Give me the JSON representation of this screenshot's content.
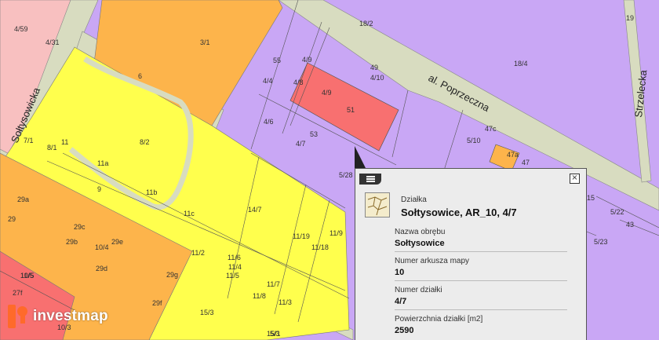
{
  "map": {
    "street_labels": [
      "Sołtysowicka",
      "al. Poprzeczna",
      "Strzelecka"
    ],
    "parcel_labels": [
      "4/59",
      "4/31",
      "3/1",
      "18/2",
      "18/4",
      "19",
      "6",
      "55",
      "4/4",
      "4/9",
      "4/8",
      "49",
      "4/10",
      "51",
      "4/9",
      "4/6",
      "53",
      "4/7",
      "47c",
      "5/10",
      "47a",
      "47",
      "5/28",
      "8/1",
      "7/1",
      "11",
      "8/2",
      "11a",
      "11b",
      "11c",
      "14/7",
      "9",
      "29a",
      "29",
      "29c",
      "29b",
      "10/4",
      "29e",
      "29d",
      "29g",
      "29f",
      "11/19",
      "11/18",
      "11/9",
      "11/6",
      "11/4",
      "11/5",
      "11/2",
      "11/7",
      "11/8",
      "11/3",
      "15/1",
      "15/3",
      "5/22",
      "43",
      "5/23",
      "11/5",
      "27f",
      "10/3",
      "10/5",
      "15",
      "5/3"
    ]
  },
  "popup": {
    "menu_icon": "list-icon",
    "close_label": "×",
    "kind": "Działka",
    "title": "Sołtysowice, AR_10, 4/7",
    "fields": [
      {
        "label": "Nazwa obrębu",
        "value": "Sołtysowice"
      },
      {
        "label": "Numer arkusza mapy",
        "value": "10"
      },
      {
        "label": "Numer działki",
        "value": "4/7"
      },
      {
        "label": "Powierzchnia działki [m2]",
        "value": "2590"
      }
    ]
  },
  "logo": {
    "text": "investmap"
  },
  "colors": {
    "purple": "#c9a7f5",
    "yellow": "#ffff4d",
    "orange": "#fdb44b",
    "red": "#f87070",
    "pink": "#f8c0c0",
    "road": "#d8dcc0"
  }
}
